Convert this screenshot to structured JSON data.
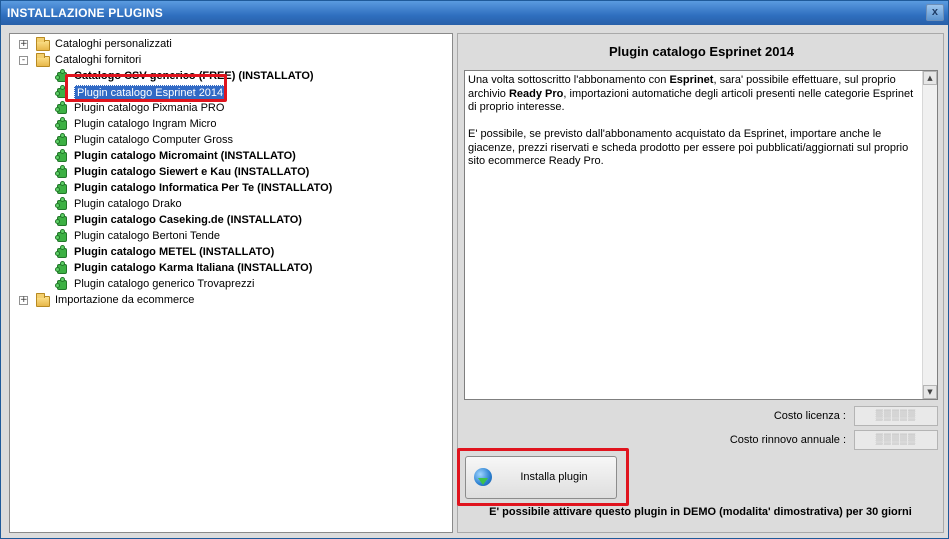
{
  "window": {
    "title": "INSTALLAZIONE PLUGINS",
    "close_label": "x"
  },
  "tree": {
    "items": [
      {
        "label": "Cataloghi personalizzati",
        "kind": "folder",
        "level": 0,
        "expander": "+",
        "bold": false
      },
      {
        "label": "Cataloghi fornitori",
        "kind": "folder",
        "level": 0,
        "expander": "-",
        "bold": false
      },
      {
        "label": "Catalogo CSV generico (FREE) (INSTALLATO)",
        "kind": "plugin",
        "level": 1,
        "bold": true
      },
      {
        "label": "Plugin catalogo Esprinet 2014",
        "kind": "plugin",
        "level": 1,
        "bold": false,
        "selected": true
      },
      {
        "label": "Plugin catalogo Pixmania PRO",
        "kind": "plugin",
        "level": 1,
        "bold": false
      },
      {
        "label": "Plugin catalogo Ingram Micro",
        "kind": "plugin",
        "level": 1,
        "bold": false
      },
      {
        "label": "Plugin catalogo Computer Gross",
        "kind": "plugin",
        "level": 1,
        "bold": false
      },
      {
        "label": "Plugin catalogo Micromaint (INSTALLATO)",
        "kind": "plugin",
        "level": 1,
        "bold": true
      },
      {
        "label": "Plugin catalogo Siewert e Kau (INSTALLATO)",
        "kind": "plugin",
        "level": 1,
        "bold": true
      },
      {
        "label": "Plugin catalogo Informatica Per Te (INSTALLATO)",
        "kind": "plugin",
        "level": 1,
        "bold": true
      },
      {
        "label": "Plugin catalogo Drako",
        "kind": "plugin",
        "level": 1,
        "bold": false
      },
      {
        "label": "Plugin catalogo Caseking.de (INSTALLATO)",
        "kind": "plugin",
        "level": 1,
        "bold": true
      },
      {
        "label": "Plugin catalogo Bertoni Tende",
        "kind": "plugin",
        "level": 1,
        "bold": false
      },
      {
        "label": "Plugin catalogo METEL (INSTALLATO)",
        "kind": "plugin",
        "level": 1,
        "bold": true
      },
      {
        "label": "Plugin catalogo Karma Italiana (INSTALLATO)",
        "kind": "plugin",
        "level": 1,
        "bold": true
      },
      {
        "label": "Plugin catalogo generico Trovaprezzi",
        "kind": "plugin",
        "level": 1,
        "bold": false
      },
      {
        "label": "Importazione da ecommerce",
        "kind": "folder",
        "level": 0,
        "expander": "+",
        "bold": false
      }
    ]
  },
  "detail": {
    "title": "Plugin catalogo Esprinet 2014",
    "paragraph1": {
      "a": "Una volta sottoscritto l'abbonamento con ",
      "b": "Esprinet",
      "c": ", sara' possibile effettuare, sul proprio archivio ",
      "d": "Ready Pro",
      "e": ", importazioni automatiche degli articoli presenti nelle categorie Esprinet di proprio interesse."
    },
    "paragraph2": "E' possibile, se previsto dall'abbonamento acquistato da Esprinet, importare anche le giacenze, prezzi riservati e scheda prodotto per essere poi pubblicati/aggiornati sul proprio sito ecommerce Ready Pro.",
    "costo_licenza_label": "Costo licenza :",
    "costo_licenza_value": "▒▒▒▒▒",
    "costo_rinnovo_label": "Costo rinnovo annuale :",
    "costo_rinnovo_value": "▒▒▒▒▒",
    "install_label": "Installa plugin",
    "demo_note": "E' possibile attivare questo plugin in DEMO (modalita' dimostrativa) per 30 giorni"
  },
  "icons": {
    "folder": "folder-icon",
    "plugin": "puzzle-plugin-icon",
    "install": "install-globe-icon"
  },
  "colors": {
    "highlight": "#e0141e",
    "selection": "#316ac5",
    "titlebar": "#2f6fbf"
  }
}
